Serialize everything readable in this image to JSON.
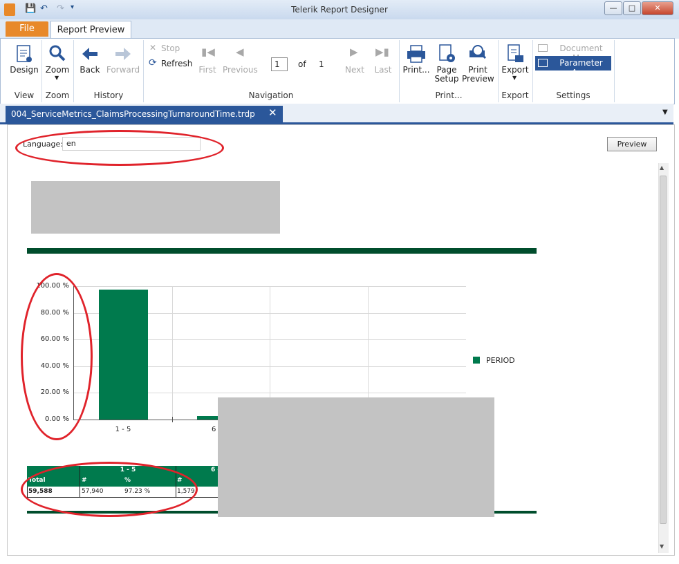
{
  "window": {
    "title": "Telerik Report Designer"
  },
  "ribbon": {
    "tabs": {
      "file": "File",
      "report_preview": "Report Preview"
    },
    "groups": {
      "view": "View",
      "zoom": "Zoom",
      "history": "History",
      "navigation": "Navigation",
      "print": "Print...",
      "export": "Export",
      "settings": "Settings"
    },
    "buttons": {
      "design": "Design",
      "zoom": "Zoom",
      "back": "Back",
      "forward": "Forward",
      "stop": "Stop",
      "refresh": "Refresh",
      "first": "First",
      "previous": "Previous",
      "next": "Next",
      "last": "Last",
      "print": "Print...",
      "page_setup_1": "Page",
      "page_setup_2": "Setup",
      "print_preview_1": "Print",
      "print_preview_2": "Preview",
      "export": "Export",
      "document_map": "Document Map",
      "parameter_area": "Parameter Area"
    },
    "page_input": "1",
    "of_label": "of",
    "total_pages": "1"
  },
  "document_tab": {
    "label": "004_ServiceMetrics_ClaimsProcessingTurnaroundTime.trdp [Preview]"
  },
  "parameters": {
    "language_label": "Language:",
    "language_value": "en",
    "preview_button": "Preview"
  },
  "chart_data": {
    "type": "bar",
    "categories": [
      "1 - 5",
      "6 -"
    ],
    "series": [
      {
        "name": "PERIOD",
        "values": [
          97.23,
          2.65
        ]
      }
    ],
    "ylim": [
      0,
      100
    ],
    "ytick_labels": [
      "100.00 %",
      "80.00 %",
      "60.00 %",
      "40.00 %",
      "20.00 %",
      "0.00 %"
    ],
    "yticks": [
      100,
      80,
      60,
      40,
      20,
      0
    ],
    "legend_position": "right",
    "grid": true,
    "color": "#007a4d"
  },
  "table": {
    "group_headers": [
      "1 - 5",
      "6 -"
    ],
    "sub_headers": [
      "Total",
      "#",
      "%",
      "#"
    ],
    "row": [
      "59,588",
      "57,940",
      "97.23 %",
      "1,579"
    ]
  },
  "colors": {
    "accent": "#2b579a",
    "file_tab": "#e8892a",
    "bar": "#007a4d",
    "rule": "#004d2c",
    "annotation": "#e0232b",
    "redaction": "#c3c3c3"
  }
}
